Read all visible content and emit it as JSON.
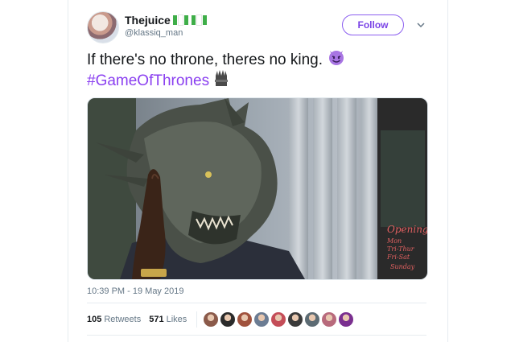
{
  "user": {
    "display_name": "Thejuice",
    "handle": "@klassiq_man",
    "follow_label": "Follow"
  },
  "tweet": {
    "text": "If there's no throne, theres no king.",
    "text_emoji": "😈",
    "hashtag": "#GameOfThrones",
    "hashtag_emoji": "throne-icon",
    "media_signage": [
      "Opening",
      "Mon",
      "Tri-Thur",
      "Fri-Sat",
      "Sunday"
    ],
    "timestamp": "10:39 PM - 19 May 2019"
  },
  "stats": {
    "retweets_count": "105",
    "retweets_label": "Retweets",
    "likes_count": "571",
    "likes_label": "Likes"
  },
  "colors": {
    "accent": "#8a3ff0",
    "follow_border": "#8c5ff0",
    "flag_green": "#3fae49",
    "muted_text": "#657786"
  },
  "liker_avatars": [
    "#8b5a4a",
    "#2b2b2b",
    "#a0523d",
    "#6b7c93",
    "#c44d58",
    "#3a3a3a",
    "#5c6b73",
    "#b86a7c",
    "#7a2f8f"
  ]
}
